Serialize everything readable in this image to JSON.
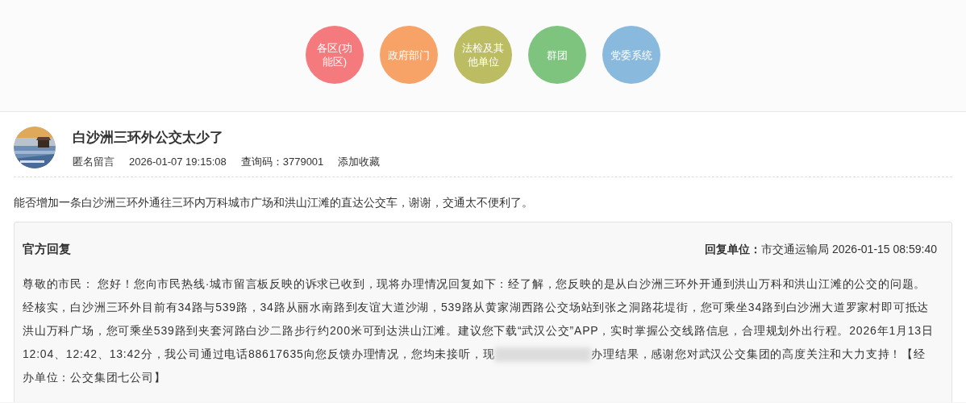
{
  "categories": [
    {
      "label": "各区(功能区)",
      "color": "#f47a7e"
    },
    {
      "label": "政府部门",
      "color": "#f7a267"
    },
    {
      "label": "法检及其他单位",
      "color": "#bcbc62"
    },
    {
      "label": "群团",
      "color": "#7ec47f"
    },
    {
      "label": "党委系统",
      "color": "#8ab9de"
    }
  ],
  "message": {
    "title": "白沙洲三环外公交太少了",
    "author": "匿名留言",
    "time": "2026-01-07 19:15:08",
    "query_code": "查询码：3779001",
    "favorite": "添加收藏",
    "content": "能否增加一条白沙洲三环外通往三环内万科城市广场和洪山江滩的直达公交车，谢谢，交通太不便利了。"
  },
  "reply": {
    "heading": "官方回复",
    "unit_label": "回复单位：",
    "unit": "市交通运输局 2026-01-15 08:59:40",
    "body_before": "尊敬的市民： 您好！您向市民热线·城市留言板反映的诉求已收到，现将办理情况回复如下：经了解，您反映的是从白沙洲三环外开通到洪山万科和洪山江滩的公交的问题。经核实，白沙洲三环外目前有34路与539路，34路从丽水南路到友谊大道沙湖，539路从黄家湖西路公交场站到张之洞路花堤街，您可乘坐34路到白沙洲大道罗家村即可抵达洪山万科广场，您可乘坐539路到夹套河路白沙二路步行约200米可到达洪山江滩。建议您下载“武汉公交”APP，实时掌握公交线路信息，合理规划外出行程。2026年1月13日12:04、12:42、13:42分，我公司通过电话88617635向您反馈办理情况，您均未接听，现",
    "body_after": "办理结果，感谢您对武汉公交集团的高度关注和大力支持！【经办单位：公交集团七公司】"
  }
}
